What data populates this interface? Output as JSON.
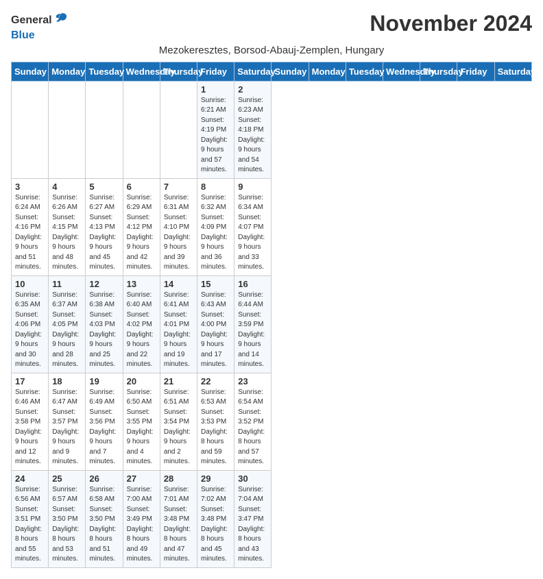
{
  "logo": {
    "general": "General",
    "blue": "Blue"
  },
  "title": "November 2024",
  "subtitle": "Mezokeresztes, Borsod-Abauj-Zemplen, Hungary",
  "weekdays": [
    "Sunday",
    "Monday",
    "Tuesday",
    "Wednesday",
    "Thursday",
    "Friday",
    "Saturday"
  ],
  "weeks": [
    [
      {
        "day": "",
        "info": ""
      },
      {
        "day": "",
        "info": ""
      },
      {
        "day": "",
        "info": ""
      },
      {
        "day": "",
        "info": ""
      },
      {
        "day": "",
        "info": ""
      },
      {
        "day": "1",
        "info": "Sunrise: 6:21 AM\nSunset: 4:19 PM\nDaylight: 9 hours\nand 57 minutes."
      },
      {
        "day": "2",
        "info": "Sunrise: 6:23 AM\nSunset: 4:18 PM\nDaylight: 9 hours\nand 54 minutes."
      }
    ],
    [
      {
        "day": "3",
        "info": "Sunrise: 6:24 AM\nSunset: 4:16 PM\nDaylight: 9 hours\nand 51 minutes."
      },
      {
        "day": "4",
        "info": "Sunrise: 6:26 AM\nSunset: 4:15 PM\nDaylight: 9 hours\nand 48 minutes."
      },
      {
        "day": "5",
        "info": "Sunrise: 6:27 AM\nSunset: 4:13 PM\nDaylight: 9 hours\nand 45 minutes."
      },
      {
        "day": "6",
        "info": "Sunrise: 6:29 AM\nSunset: 4:12 PM\nDaylight: 9 hours\nand 42 minutes."
      },
      {
        "day": "7",
        "info": "Sunrise: 6:31 AM\nSunset: 4:10 PM\nDaylight: 9 hours\nand 39 minutes."
      },
      {
        "day": "8",
        "info": "Sunrise: 6:32 AM\nSunset: 4:09 PM\nDaylight: 9 hours\nand 36 minutes."
      },
      {
        "day": "9",
        "info": "Sunrise: 6:34 AM\nSunset: 4:07 PM\nDaylight: 9 hours\nand 33 minutes."
      }
    ],
    [
      {
        "day": "10",
        "info": "Sunrise: 6:35 AM\nSunset: 4:06 PM\nDaylight: 9 hours\nand 30 minutes."
      },
      {
        "day": "11",
        "info": "Sunrise: 6:37 AM\nSunset: 4:05 PM\nDaylight: 9 hours\nand 28 minutes."
      },
      {
        "day": "12",
        "info": "Sunrise: 6:38 AM\nSunset: 4:03 PM\nDaylight: 9 hours\nand 25 minutes."
      },
      {
        "day": "13",
        "info": "Sunrise: 6:40 AM\nSunset: 4:02 PM\nDaylight: 9 hours\nand 22 minutes."
      },
      {
        "day": "14",
        "info": "Sunrise: 6:41 AM\nSunset: 4:01 PM\nDaylight: 9 hours\nand 19 minutes."
      },
      {
        "day": "15",
        "info": "Sunrise: 6:43 AM\nSunset: 4:00 PM\nDaylight: 9 hours\nand 17 minutes."
      },
      {
        "day": "16",
        "info": "Sunrise: 6:44 AM\nSunset: 3:59 PM\nDaylight: 9 hours\nand 14 minutes."
      }
    ],
    [
      {
        "day": "17",
        "info": "Sunrise: 6:46 AM\nSunset: 3:58 PM\nDaylight: 9 hours\nand 12 minutes."
      },
      {
        "day": "18",
        "info": "Sunrise: 6:47 AM\nSunset: 3:57 PM\nDaylight: 9 hours\nand 9 minutes."
      },
      {
        "day": "19",
        "info": "Sunrise: 6:49 AM\nSunset: 3:56 PM\nDaylight: 9 hours\nand 7 minutes."
      },
      {
        "day": "20",
        "info": "Sunrise: 6:50 AM\nSunset: 3:55 PM\nDaylight: 9 hours\nand 4 minutes."
      },
      {
        "day": "21",
        "info": "Sunrise: 6:51 AM\nSunset: 3:54 PM\nDaylight: 9 hours\nand 2 minutes."
      },
      {
        "day": "22",
        "info": "Sunrise: 6:53 AM\nSunset: 3:53 PM\nDaylight: 8 hours\nand 59 minutes."
      },
      {
        "day": "23",
        "info": "Sunrise: 6:54 AM\nSunset: 3:52 PM\nDaylight: 8 hours\nand 57 minutes."
      }
    ],
    [
      {
        "day": "24",
        "info": "Sunrise: 6:56 AM\nSunset: 3:51 PM\nDaylight: 8 hours\nand 55 minutes."
      },
      {
        "day": "25",
        "info": "Sunrise: 6:57 AM\nSunset: 3:50 PM\nDaylight: 8 hours\nand 53 minutes."
      },
      {
        "day": "26",
        "info": "Sunrise: 6:58 AM\nSunset: 3:50 PM\nDaylight: 8 hours\nand 51 minutes."
      },
      {
        "day": "27",
        "info": "Sunrise: 7:00 AM\nSunset: 3:49 PM\nDaylight: 8 hours\nand 49 minutes."
      },
      {
        "day": "28",
        "info": "Sunrise: 7:01 AM\nSunset: 3:48 PM\nDaylight: 8 hours\nand 47 minutes."
      },
      {
        "day": "29",
        "info": "Sunrise: 7:02 AM\nSunset: 3:48 PM\nDaylight: 8 hours\nand 45 minutes."
      },
      {
        "day": "30",
        "info": "Sunrise: 7:04 AM\nSunset: 3:47 PM\nDaylight: 8 hours\nand 43 minutes."
      }
    ]
  ]
}
